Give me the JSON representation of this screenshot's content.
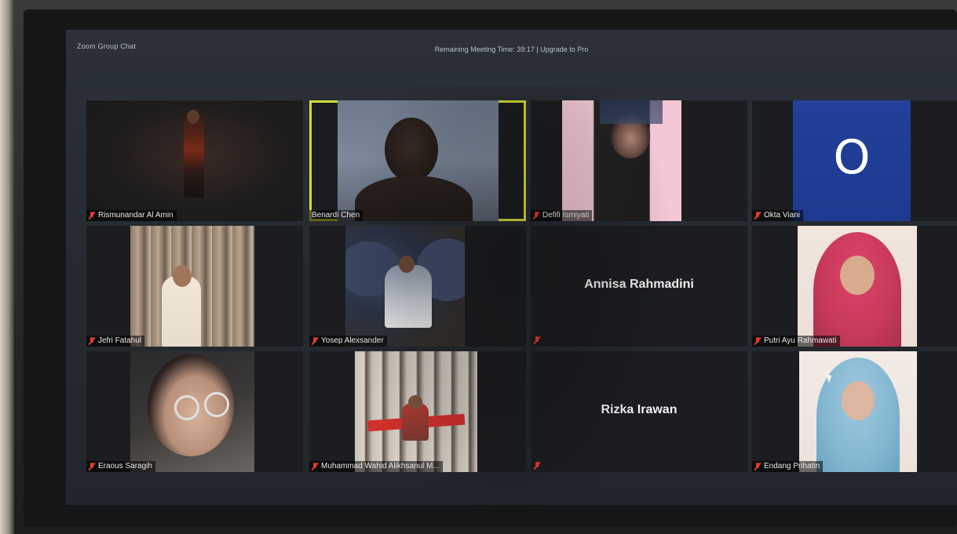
{
  "window": {
    "app_title": "Zoom Group Chat",
    "meeting_info": "Remaining Meeting Time: 39:17 | Upgrade to Pro"
  },
  "participants": [
    {
      "name": "Rismunandar Al Amin",
      "muted": true
    },
    {
      "name": "Benardi Chen",
      "muted": false,
      "active_speaker": true
    },
    {
      "name": "Defifi Ismiyati",
      "muted": true
    },
    {
      "name": "Okta Viani",
      "muted": true,
      "avatar_letter": "O"
    },
    {
      "name": "Jefri Fatahul",
      "muted": true
    },
    {
      "name": "Yosep Alexsander",
      "muted": true
    },
    {
      "name": "Annisa Rahmadini",
      "muted": true,
      "video_off": true
    },
    {
      "name": "Putri Ayu Rahmawati",
      "muted": true
    },
    {
      "name": "Eraous Saragih",
      "muted": true
    },
    {
      "name": "Muhammad Wahid Alikhsanul M...",
      "muted": true
    },
    {
      "name": "Rizka Irawan",
      "muted": true,
      "video_off": true
    },
    {
      "name": "Endang Prihatin",
      "muted": true
    }
  ],
  "colors": {
    "active_speaker_border": "#d4da3a",
    "muted_icon": "#e23b2e",
    "avatar_bg": "#1f3a8f"
  }
}
